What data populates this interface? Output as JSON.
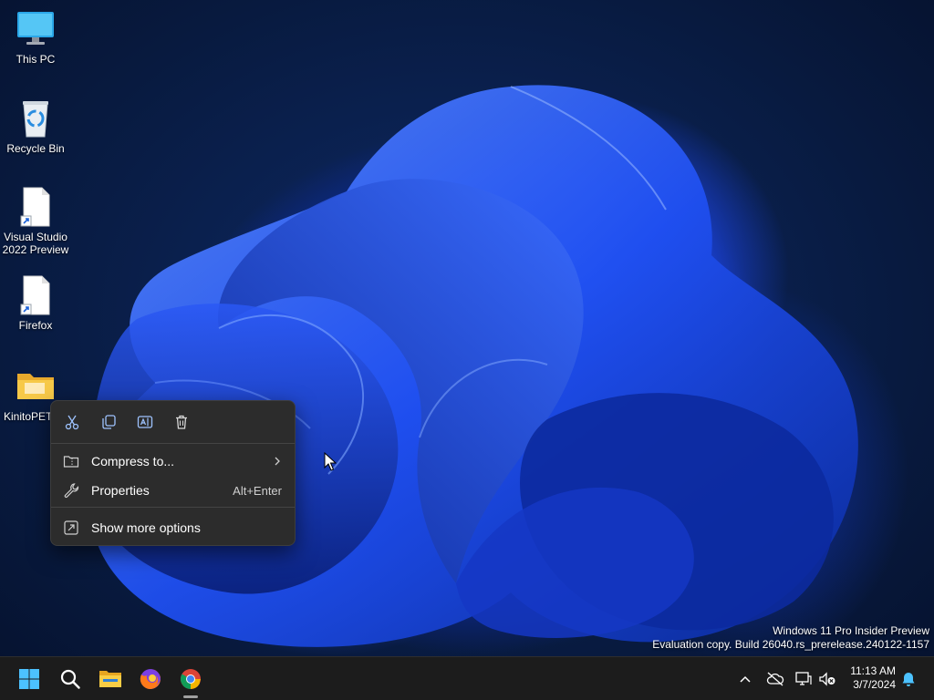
{
  "desktop": {
    "icons": [
      {
        "label": "This PC",
        "icon": "this-pc-icon"
      },
      {
        "label": "Recycle Bin",
        "icon": "recycle-bin-icon"
      },
      {
        "label": "Visual Studio 2022 Preview",
        "icon": "shortcut-file-icon"
      },
      {
        "label": "Firefox",
        "icon": "shortcut-file-icon"
      },
      {
        "label": "KinitoPET",
        "icon": "folder-icon"
      }
    ]
  },
  "context_menu": {
    "quick_actions": [
      {
        "name": "cut",
        "icon": "scissors-icon"
      },
      {
        "name": "copy",
        "icon": "copy-icon"
      },
      {
        "name": "rename",
        "icon": "rename-icon"
      },
      {
        "name": "delete",
        "icon": "trash-icon"
      }
    ],
    "items": [
      {
        "label": "Compress to...",
        "icon": "zip-folder-icon",
        "shortcut": "",
        "submenu": true
      },
      {
        "label": "Properties",
        "icon": "wrench-icon",
        "shortcut": "Alt+Enter",
        "submenu": false
      },
      {
        "label": "Show more options",
        "icon": "more-options-icon",
        "shortcut": "",
        "submenu": false
      }
    ]
  },
  "watermark": {
    "line1": "Windows 11 Pro Insider Preview",
    "line2": "Evaluation copy. Build 26040.rs_prerelease.240122-1157"
  },
  "taskbar": {
    "apps": [
      {
        "name": "start",
        "icon": "windows-start-icon"
      },
      {
        "name": "search",
        "icon": "search-icon"
      },
      {
        "name": "file-explorer",
        "icon": "file-explorer-icon"
      },
      {
        "name": "firefox",
        "icon": "firefox-icon"
      },
      {
        "name": "chrome",
        "icon": "chrome-icon"
      }
    ],
    "clock": {
      "time": "11:13 AM",
      "date": "3/7/2024"
    }
  },
  "colors": {
    "accent": "#0067c0",
    "menu_bg": "#2c2c2c",
    "taskbar_bg": "#1c1c1c"
  }
}
